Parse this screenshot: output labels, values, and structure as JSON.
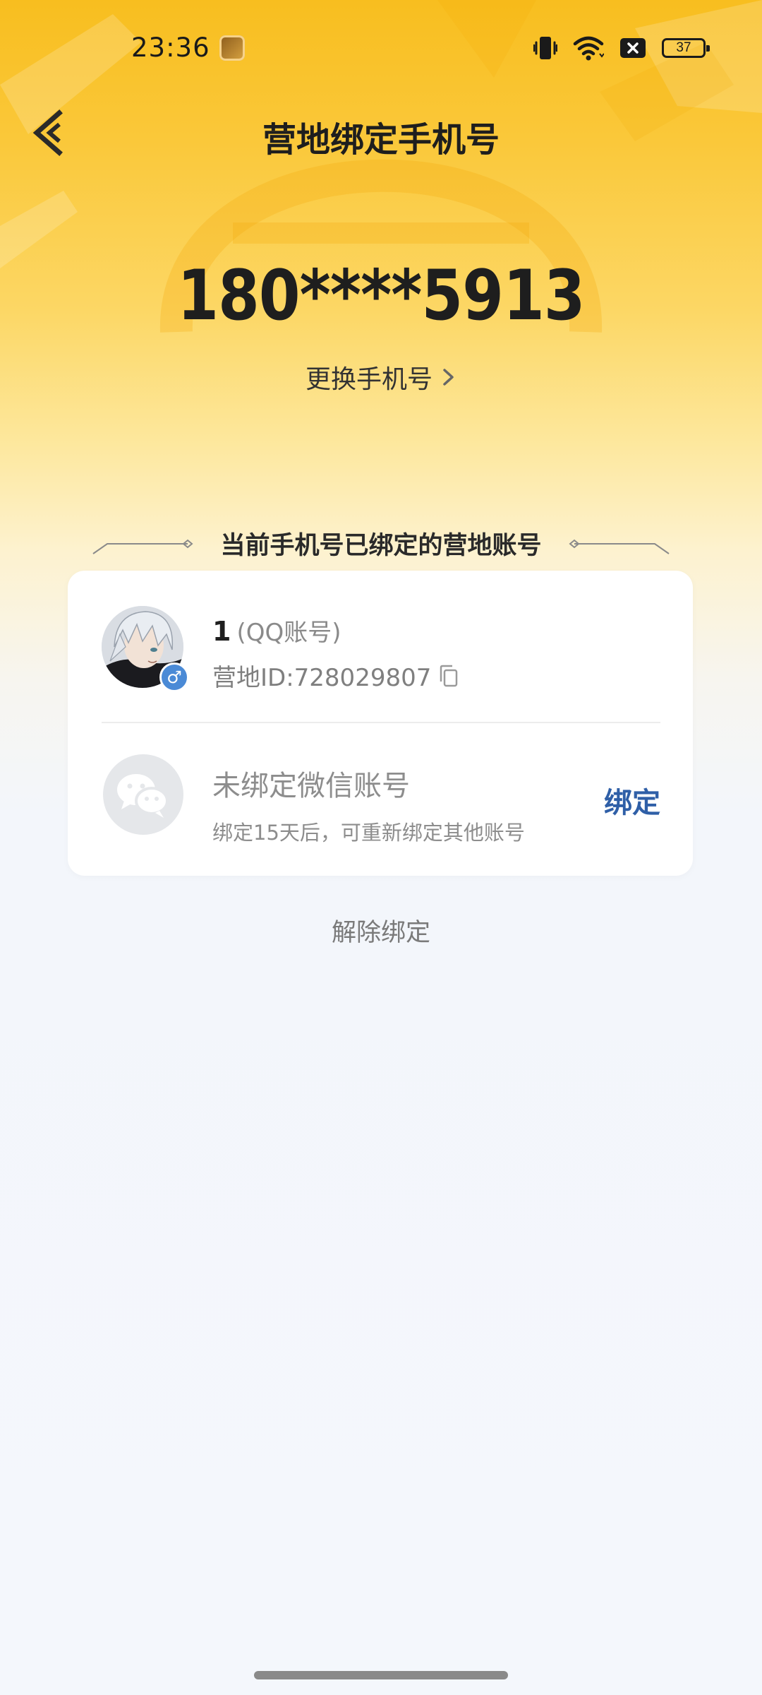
{
  "status_bar": {
    "time": "23:36",
    "battery": "37",
    "icons": [
      "app-notification-icon",
      "vibrate-icon",
      "wifi-icon",
      "sim-off-icon",
      "battery-icon"
    ]
  },
  "header": {
    "title": "营地绑定手机号",
    "back_icon": "chevron-left-icon"
  },
  "phone": {
    "number": "180****5913",
    "change_label": "更换手机号"
  },
  "section": {
    "title": "当前手机号已绑定的营地账号"
  },
  "accounts": {
    "qq": {
      "name": "1",
      "type": "(QQ账号)",
      "id_label": "营地ID:728029807",
      "gender_symbol": "♂"
    },
    "wechat": {
      "title": "未绑定微信账号",
      "note": "绑定15天后，可重新绑定其他账号",
      "bind_label": "绑定"
    }
  },
  "footer": {
    "unbind_label": "解除绑定"
  },
  "colors": {
    "accent_yellow": "#f8be1f",
    "link_blue": "#2f5fa7",
    "gender_blue": "#4a8ad6"
  }
}
